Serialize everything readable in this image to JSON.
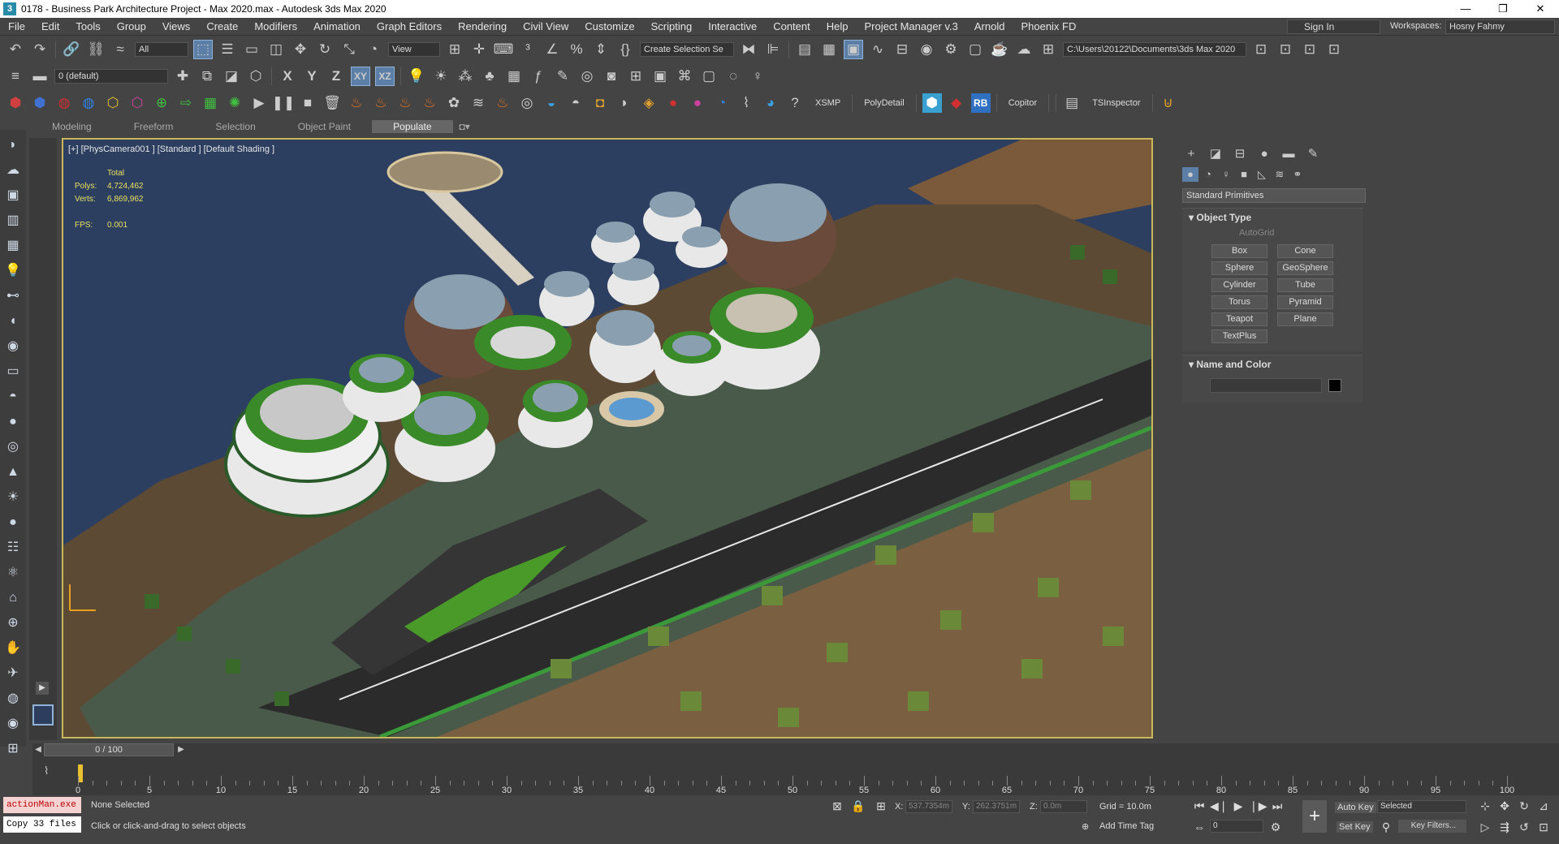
{
  "titlebar": {
    "app_icon": "3",
    "title": "0178 - Business Park Architecture Project - Max 2020.max - Autodesk 3ds Max 2020",
    "minimize": "—",
    "maximize": "❐",
    "close": "✕"
  },
  "menu": {
    "items": [
      "File",
      "Edit",
      "Tools",
      "Group",
      "Views",
      "Create",
      "Modifiers",
      "Animation",
      "Graph Editors",
      "Rendering",
      "Civil View",
      "Customize",
      "Scripting",
      "Interactive",
      "Content",
      "Help",
      "Project Manager v.3",
      "Arnold",
      "Phoenix FD"
    ],
    "sign_in": "Sign In",
    "workspaces_label": "Workspaces:",
    "workspace": "Hosny Fahmy"
  },
  "toolbar1": {
    "selection_filter": "All",
    "ref_coord": "View",
    "named_selection": "Create Selection Se",
    "project_path": "C:\\Users\\20122\\Documents\\3ds Max 2020"
  },
  "toolbar2": {
    "layer": "0 (default)",
    "axes": [
      "X",
      "Y",
      "Z",
      "XY",
      "XZ"
    ]
  },
  "toolbar3": {
    "buttons": [
      "XSMP",
      "PolyDetail",
      "RB",
      "Copitor",
      "TSInspector"
    ]
  },
  "ribbon": {
    "tabs": [
      "Modeling",
      "Freeform",
      "Selection",
      "Object Paint",
      "Populate"
    ],
    "active": "Populate"
  },
  "viewport": {
    "label": "[+] [PhysCamera001 ] [Standard ] [Default Shading ]",
    "stats": {
      "total_label": "Total",
      "polys_label": "Polys:",
      "polys": "4,724,462",
      "verts_label": "Verts:",
      "verts": "6,869,962",
      "fps_label": "FPS:",
      "fps": "0.001"
    }
  },
  "command_panel": {
    "category": "Standard Primitives",
    "object_type_title": "Object Type",
    "autogrid": "AutoGrid",
    "primitives": [
      "Box",
      "Cone",
      "Sphere",
      "GeoSphere",
      "Cylinder",
      "Tube",
      "Torus",
      "Pyramid",
      "Teapot",
      "Plane",
      "TextPlus"
    ],
    "name_color_title": "Name and Color"
  },
  "timeline": {
    "slider": "0 / 100",
    "ticks": [
      "0",
      "5",
      "10",
      "15",
      "20",
      "25",
      "30",
      "35",
      "40",
      "45",
      "50",
      "55",
      "60",
      "65",
      "70",
      "75",
      "80",
      "85",
      "90",
      "95",
      "100"
    ]
  },
  "status": {
    "maxscript_line1": "actionMan.exe",
    "maxscript_line2": "Copy 33 files",
    "selection": "None Selected",
    "prompt": "Click or click-and-drag to select objects",
    "x_label": "X:",
    "x": "537.7354m",
    "y_label": "Y:",
    "y": "262.3751m",
    "z_label": "Z:",
    "z": "0.0m",
    "grid": "Grid = 10.0m",
    "add_time_tag": "Add Time Tag",
    "auto_key": "Auto Key",
    "set_key": "Set Key",
    "key_mode": "Selected",
    "key_filters": "Key Filters...",
    "frame": "0"
  }
}
